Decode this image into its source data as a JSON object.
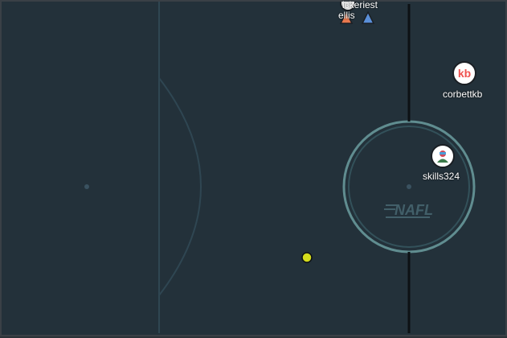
{
  "players": [
    {
      "name": "corbettkb",
      "avatar_text": "kb",
      "avatar_color": "#ef5350"
    },
    {
      "name": "skills324",
      "avatar_text": "",
      "avatar_color": "#d14b5a"
    },
    {
      "name": "ellis",
      "avatar_text": "",
      "avatar_color": "#e8784e"
    },
    {
      "name": "ickeriest",
      "avatar_text": "",
      "avatar_color": "#5a8fd8"
    }
  ],
  "field": {
    "logo_text": "NAFL",
    "field_color": "#23313a",
    "line_color": "#2f4652",
    "center_circle_color": "#6b9ea0",
    "ball_color": "#d4dc1c"
  }
}
